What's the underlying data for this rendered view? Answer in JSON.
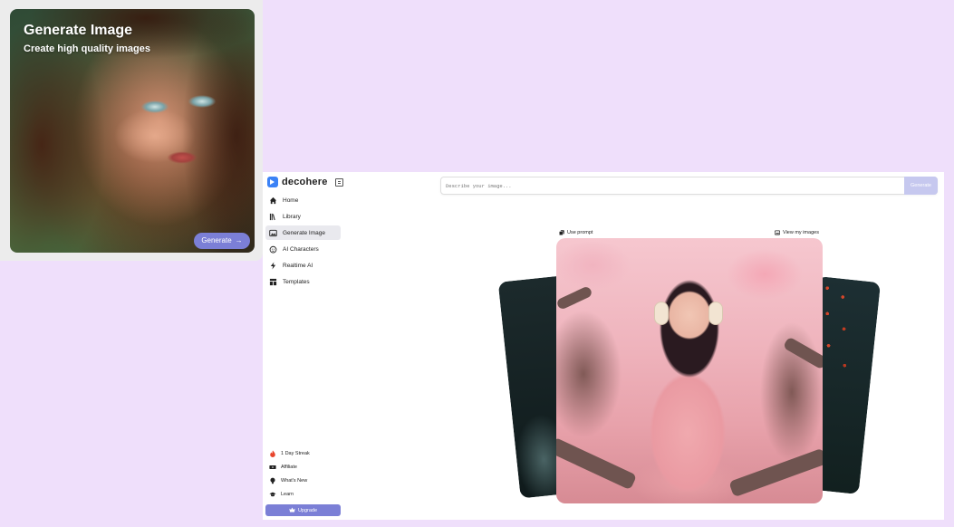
{
  "promo": {
    "title": "Generate Image",
    "subtitle": "Create high quality images",
    "button_label": "Generate",
    "button_icon": "arrow-right-icon"
  },
  "brand": {
    "name": "decohere"
  },
  "sidebar": {
    "items": [
      {
        "label": "Home",
        "icon": "home-icon"
      },
      {
        "label": "Library",
        "icon": "library-icon"
      },
      {
        "label": "Generate Image",
        "icon": "image-icon",
        "active": true
      },
      {
        "label": "AI Characters",
        "icon": "character-icon"
      },
      {
        "label": "Realtime AI",
        "icon": "lightning-icon"
      },
      {
        "label": "Templates",
        "icon": "templates-icon"
      }
    ],
    "bottom_items": [
      {
        "label": "1 Day Streak",
        "icon": "fire-icon"
      },
      {
        "label": "Affiliate",
        "icon": "ticket-icon"
      },
      {
        "label": "What's New",
        "icon": "lightbulb-icon"
      },
      {
        "label": "Learn",
        "icon": "graduation-cap-icon"
      }
    ],
    "upgrade_label": "Upgrade"
  },
  "prompt": {
    "placeholder": "Describe your image...",
    "generate_label": "Generate"
  },
  "gallery": {
    "use_prompt_label": "Use prompt",
    "view_images_label": "View my images"
  },
  "colors": {
    "page_background": "#efdffb",
    "accent": "#7b7fd6",
    "generate_disabled": "#c6c8ef"
  }
}
